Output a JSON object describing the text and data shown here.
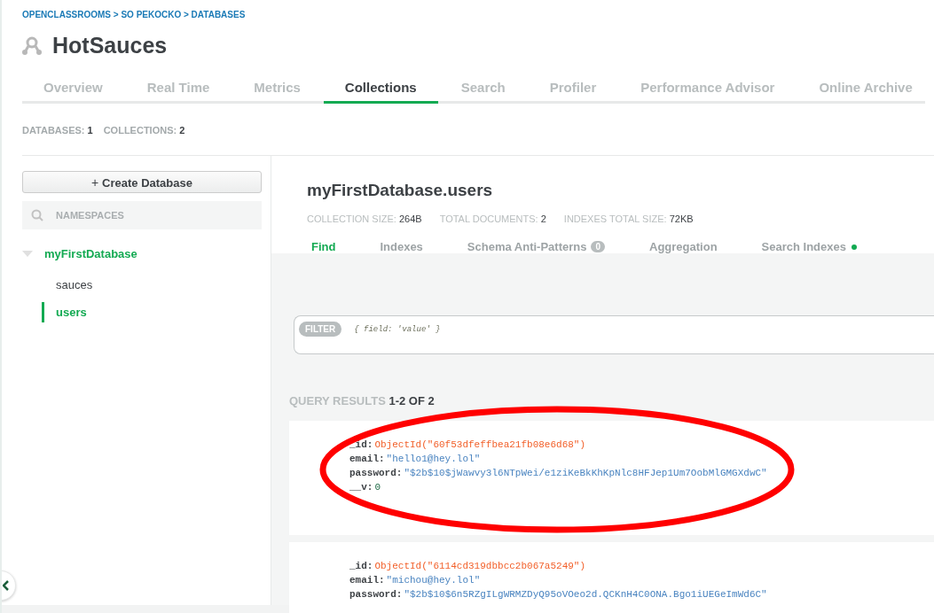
{
  "breadcrumb": "OPENCLASSROOMS > SO PEKOCKO > DATABASES",
  "title": "HotSauces",
  "tabs": [
    {
      "label": "Overview",
      "selected": false
    },
    {
      "label": "Real Time",
      "selected": false
    },
    {
      "label": "Metrics",
      "selected": false
    },
    {
      "label": "Collections",
      "selected": true
    },
    {
      "label": "Search",
      "selected": false
    },
    {
      "label": "Profiler",
      "selected": false
    },
    {
      "label": "Performance Advisor",
      "selected": false
    },
    {
      "label": "Online Archive",
      "selected": false
    }
  ],
  "summary": [
    {
      "label": "DATABASES:",
      "value": "1"
    },
    {
      "label": "COLLECTIONS:",
      "value": "2"
    }
  ],
  "sidebar": {
    "create_button": "Create Database",
    "create_icon": "+",
    "search": {
      "placeholder": "NAMESPACES"
    },
    "databases": [
      {
        "name": "myFirstDatabase",
        "expanded": true,
        "children": [
          {
            "name": "sauces",
            "selected": false
          },
          {
            "name": "users",
            "selected": true
          }
        ]
      }
    ]
  },
  "collection": {
    "name": "myFirstDatabase.users",
    "stats": [
      {
        "label": "COLLECTION SIZE:",
        "value": "264B"
      },
      {
        "label": "TOTAL DOCUMENTS:",
        "value": "2"
      },
      {
        "label": "INDEXES TOTAL SIZE:",
        "value": "72KB"
      }
    ],
    "tabs": [
      {
        "label": "Find",
        "selected": true
      },
      {
        "label": "Indexes",
        "selected": false
      },
      {
        "label": "Schema Anti-Patterns",
        "selected": false,
        "badge": "0"
      },
      {
        "label": "Aggregation",
        "selected": false
      },
      {
        "label": "Search Indexes",
        "selected": false,
        "status_dot": true
      }
    ],
    "filter": {
      "label": "FILTER",
      "placeholder": "{ field: 'value' }"
    },
    "results": {
      "label": "QUERY RESULTS",
      "range": "1-2 OF 2"
    },
    "documents": [
      {
        "fields": [
          {
            "key": "_id:",
            "value": "ObjectId(\"60f53dfeffbea21fb08e6d68\")",
            "kind": "objectid"
          },
          {
            "key": "email:",
            "value": "\"hello1@hey.lol\"",
            "kind": "string"
          },
          {
            "key": "password:",
            "value": "\"$2b$10$jWawvy3l6NTpWei/e1ziKeBkKhKpNlc8HFJep1Um7OobMlGMGXdwC\"",
            "kind": "string"
          },
          {
            "key": "__v:",
            "value": "0",
            "kind": "number"
          }
        ]
      },
      {
        "fields": [
          {
            "key": "_id:",
            "value": "ObjectId(\"6114cd319dbbcc2b067a5249\")",
            "kind": "objectid"
          },
          {
            "key": "email:",
            "value": "\"michou@hey.lol\"",
            "kind": "string"
          },
          {
            "key": "password:",
            "value": "\"$2b$10$6n5RZgILgWRMZDyQ95oVOeo2d.QCKnH4C0ONA.Bgo1iUEGeImWd6C\"",
            "kind": "string"
          }
        ]
      }
    ]
  },
  "annotation": {
    "kind": "ellipse",
    "color": "#ff0000"
  }
}
